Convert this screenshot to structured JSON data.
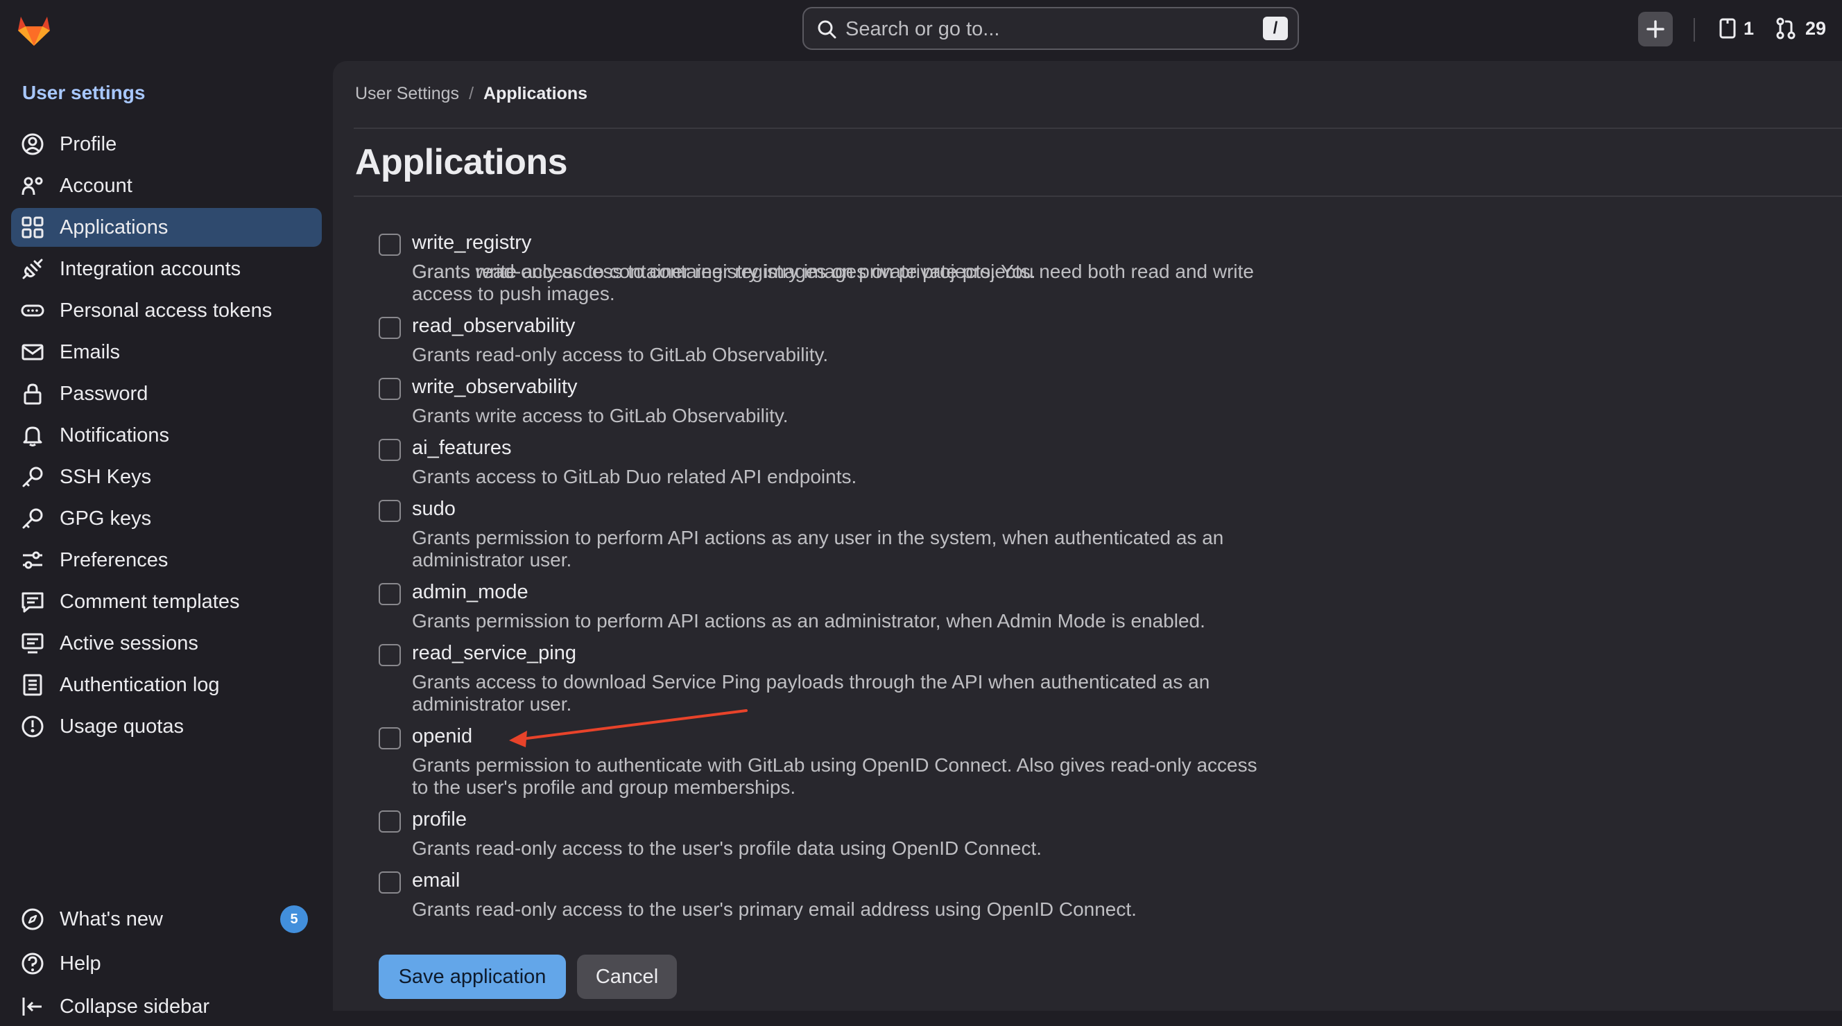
{
  "topbar": {
    "search_placeholder": "Search or go to...",
    "search_shortcut": "/",
    "issues_count": "1",
    "merge_requests_count": "29"
  },
  "sidebar": {
    "title": "User settings",
    "items": [
      {
        "label": "Profile",
        "icon": "profile-icon"
      },
      {
        "label": "Account",
        "icon": "account-icon"
      },
      {
        "label": "Applications",
        "icon": "applications-icon",
        "active": true
      },
      {
        "label": "Integration accounts",
        "icon": "plug-icon"
      },
      {
        "label": "Personal access tokens",
        "icon": "token-icon"
      },
      {
        "label": "Emails",
        "icon": "mail-icon"
      },
      {
        "label": "Password",
        "icon": "lock-icon"
      },
      {
        "label": "Notifications",
        "icon": "bell-icon"
      },
      {
        "label": "SSH Keys",
        "icon": "key-icon"
      },
      {
        "label": "GPG keys",
        "icon": "key-icon"
      },
      {
        "label": "Preferences",
        "icon": "preferences-icon"
      },
      {
        "label": "Comment templates",
        "icon": "comment-icon"
      },
      {
        "label": "Active sessions",
        "icon": "monitor-icon"
      },
      {
        "label": "Authentication log",
        "icon": "log-icon"
      },
      {
        "label": "Usage quotas",
        "icon": "quota-icon"
      }
    ],
    "bottom": [
      {
        "label": "What's new",
        "icon": "compass-icon",
        "badge": "5"
      },
      {
        "label": "Help",
        "icon": "help-icon"
      },
      {
        "label": "Collapse sidebar",
        "icon": "collapse-icon"
      }
    ]
  },
  "breadcrumb": {
    "parent": "User Settings",
    "separator": "/",
    "current": "Applications"
  },
  "page_title": "Applications",
  "scopes": {
    "top_desc": "Grants read-only access to container registry images on private projects.",
    "items": [
      {
        "name": "write_registry",
        "desc": "Grants write access to container registry images on private projects. You need both read and write access to push images.",
        "checked": false
      },
      {
        "name": "read_observability",
        "desc": "Grants read-only access to GitLab Observability.",
        "checked": false
      },
      {
        "name": "write_observability",
        "desc": "Grants write access to GitLab Observability.",
        "checked": false
      },
      {
        "name": "ai_features",
        "desc": "Grants access to GitLab Duo related API endpoints.",
        "checked": false
      },
      {
        "name": "sudo",
        "desc": "Grants permission to perform API actions as any user in the system, when authenticated as an administrator user.",
        "checked": false
      },
      {
        "name": "admin_mode",
        "desc": "Grants permission to perform API actions as an administrator, when Admin Mode is enabled.",
        "checked": false
      },
      {
        "name": "read_service_ping",
        "desc": "Grants access to download Service Ping payloads through the API when authenticated as an administrator user.",
        "checked": false
      },
      {
        "name": "openid",
        "desc": "Grants permission to authenticate with GitLab using OpenID Connect. Also gives read-only access to the user's profile and group memberships.",
        "checked": false
      },
      {
        "name": "profile",
        "desc": "Grants read-only access to the user's profile data using OpenID Connect.",
        "checked": false
      },
      {
        "name": "email",
        "desc": "Grants read-only access to the user's primary email address using OpenID Connect.",
        "checked": false
      }
    ]
  },
  "actions": {
    "save_label": "Save application",
    "cancel_label": "Cancel"
  },
  "colors": {
    "accent": "#63a6e9",
    "annotation_arrow": "#e8432a",
    "active_nav": "#2f4a6e"
  }
}
